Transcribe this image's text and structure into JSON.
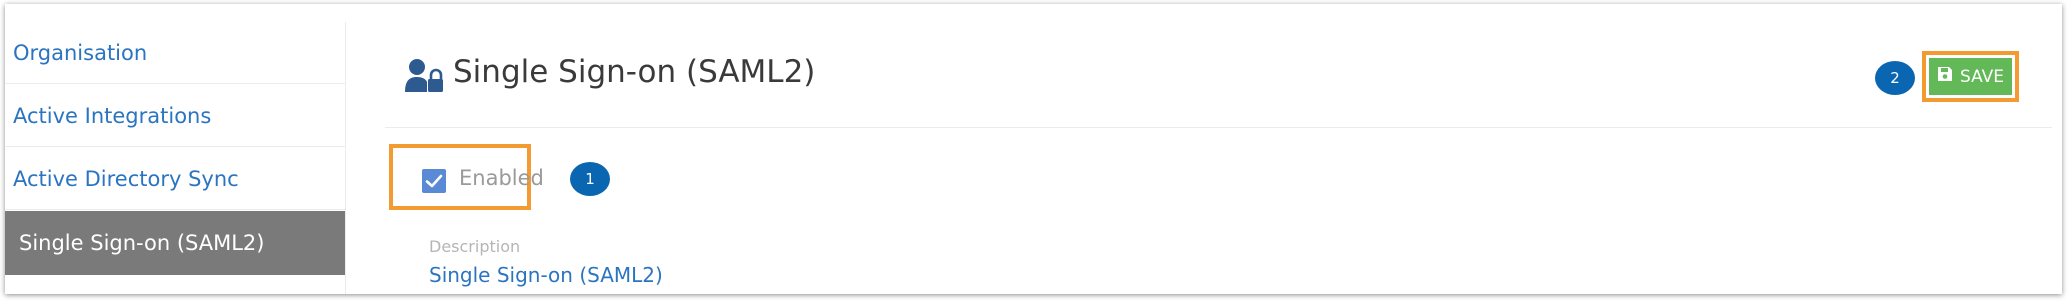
{
  "sidebar": {
    "items": [
      {
        "label": "Organisation",
        "active": false
      },
      {
        "label": "Active Integrations",
        "active": false
      },
      {
        "label": "Active Directory Sync",
        "active": false
      },
      {
        "label": "Single Sign-on (SAML2)",
        "active": true
      }
    ]
  },
  "header": {
    "title": "Single Sign-on (SAML2)",
    "icon": "user-lock-icon"
  },
  "toolbar": {
    "save_label": "SAVE",
    "save_icon": "floppy-disk-icon"
  },
  "form": {
    "enabled_label": "Enabled",
    "enabled_checked": true,
    "description_label": "Description",
    "description_value": "Single Sign-on (SAML2)"
  },
  "annotations": {
    "marker_1": "1",
    "marker_2": "2"
  },
  "colors": {
    "link": "#2b74c0",
    "active_sidebar_bg": "#7a7a7a",
    "save_button": "#63b958",
    "highlight_border": "#f39a31",
    "marker": "#0a66b1",
    "checkbox": "#5a8ad6"
  }
}
